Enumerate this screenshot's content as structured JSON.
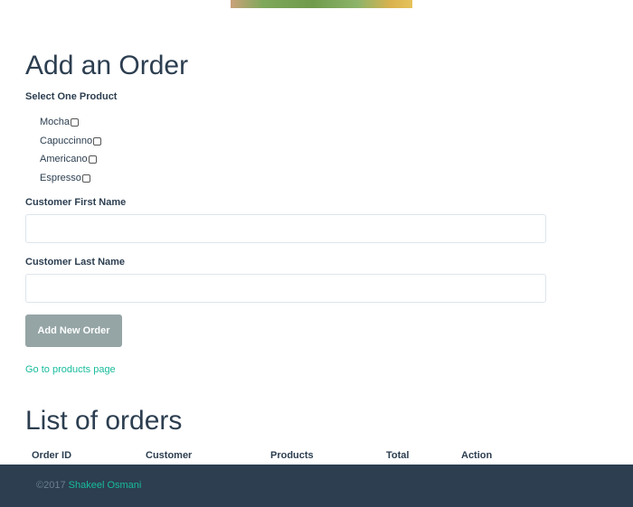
{
  "form": {
    "title": "Add an Order",
    "select_label": "Select One Product",
    "products": [
      {
        "label": "Mocha",
        "checked": false
      },
      {
        "label": "Capuccinno",
        "checked": false
      },
      {
        "label": "Americano",
        "checked": false
      },
      {
        "label": "Espresso",
        "checked": false
      }
    ],
    "first_name_label": "Customer First Name",
    "first_name_value": "",
    "last_name_label": "Customer Last Name",
    "last_name_value": "",
    "submit_label": "Add New Order",
    "products_link": "Go to products page"
  },
  "orders": {
    "title": "List of orders",
    "columns": [
      "Order ID",
      "Customer",
      "Products",
      "Total",
      "Action"
    ]
  },
  "footer": {
    "copyright": "©2017",
    "author": "Shakeel Osmani"
  },
  "colors": {
    "text": "#2c3e50",
    "accent": "#18bc9c",
    "button": "#95a5a6",
    "footer": "#2c3e50"
  }
}
